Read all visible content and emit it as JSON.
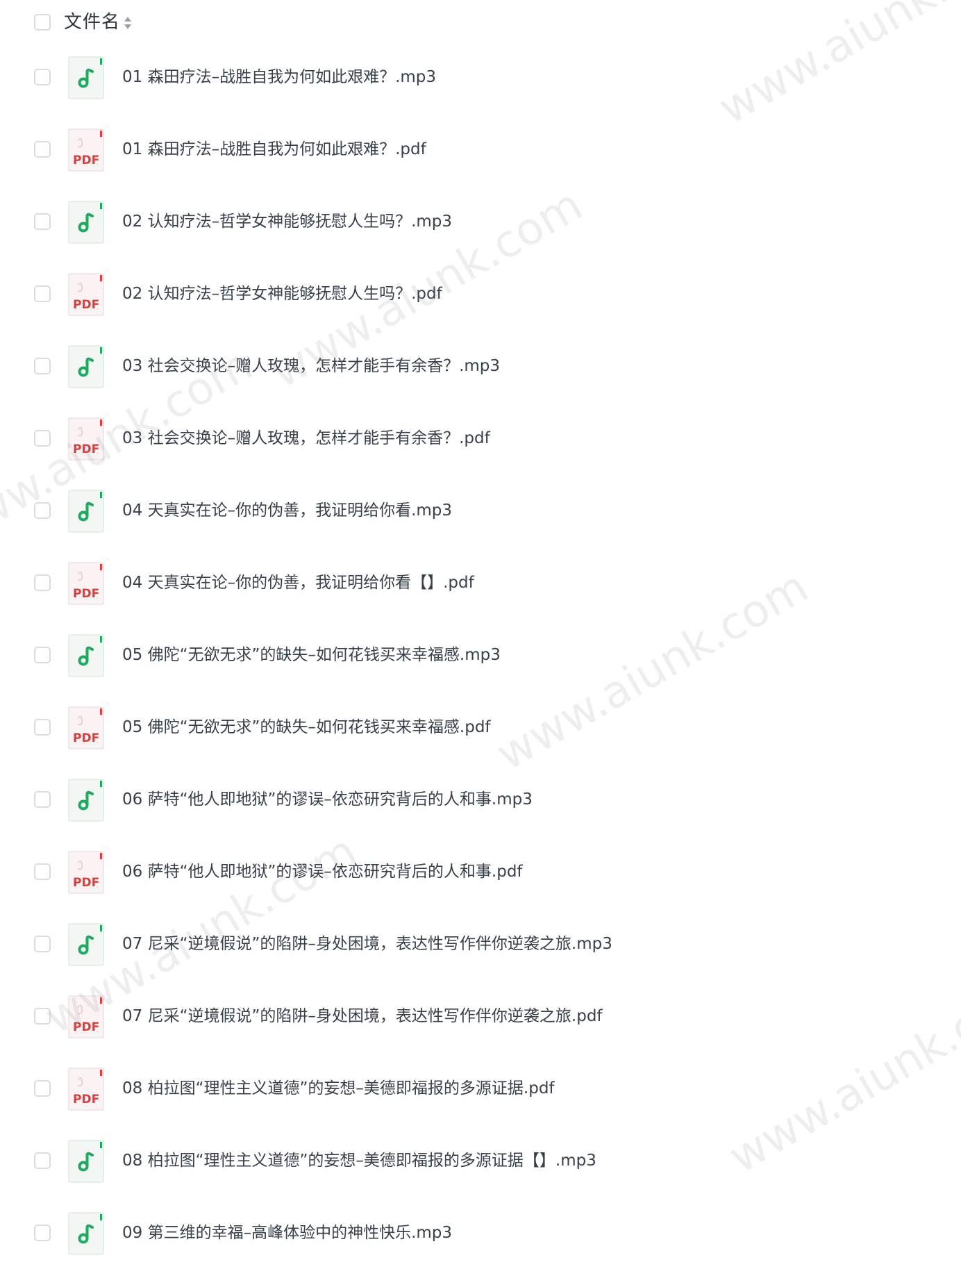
{
  "header": {
    "column_label": "文件名"
  },
  "files": [
    {
      "name": "01 森田疗法–战胜自我为何如此艰难？.mp3",
      "type": "audio"
    },
    {
      "name": "01 森田疗法–战胜自我为何如此艰难？.pdf",
      "type": "pdf"
    },
    {
      "name": "02 认知疗法–哲学女神能够抚慰人生吗？.mp3",
      "type": "audio"
    },
    {
      "name": "02 认知疗法–哲学女神能够抚慰人生吗？.pdf",
      "type": "pdf"
    },
    {
      "name": "03 社会交换论–赠人玫瑰，怎样才能手有余香？.mp3",
      "type": "audio"
    },
    {
      "name": "03 社会交换论–赠人玫瑰，怎样才能手有余香？.pdf",
      "type": "pdf"
    },
    {
      "name": "04 天真实在论–你的伪善，我证明给你看.mp3",
      "type": "audio"
    },
    {
      "name": "04 天真实在论–你的伪善，我证明给你看【】.pdf",
      "type": "pdf"
    },
    {
      "name": "05 佛陀“无欲无求”的缺失–如何花钱买来幸福感.mp3",
      "type": "audio"
    },
    {
      "name": "05 佛陀“无欲无求”的缺失–如何花钱买来幸福感.pdf",
      "type": "pdf"
    },
    {
      "name": "06 萨特“他人即地狱”的谬误–依恋研究背后的人和事.mp3",
      "type": "audio"
    },
    {
      "name": "06 萨特“他人即地狱”的谬误–依恋研究背后的人和事.pdf",
      "type": "pdf"
    },
    {
      "name": "07 尼采“逆境假说”的陷阱–身处困境，表达性写作伴你逆袭之旅.mp3",
      "type": "audio"
    },
    {
      "name": "07 尼采“逆境假说”的陷阱–身处困境，表达性写作伴你逆袭之旅.pdf",
      "type": "pdf"
    },
    {
      "name": "08 柏拉图“理性主义道德”的妄想–美德即福报的多源证据.pdf",
      "type": "pdf"
    },
    {
      "name": "08 柏拉图“理性主义道德”的妄想–美德即福报的多源证据【】.mp3",
      "type": "audio"
    },
    {
      "name": "09 第三维的幸福–高峰体验中的神性快乐.mp3",
      "type": "audio"
    }
  ],
  "icons": {
    "audio": {
      "name": "audio-file-icon",
      "accent": "#1fa861"
    },
    "pdf": {
      "name": "pdf-file-icon",
      "accent": "#e33b3b",
      "label": "PDF"
    }
  },
  "watermark": {
    "text": "www.aiunk.com"
  }
}
